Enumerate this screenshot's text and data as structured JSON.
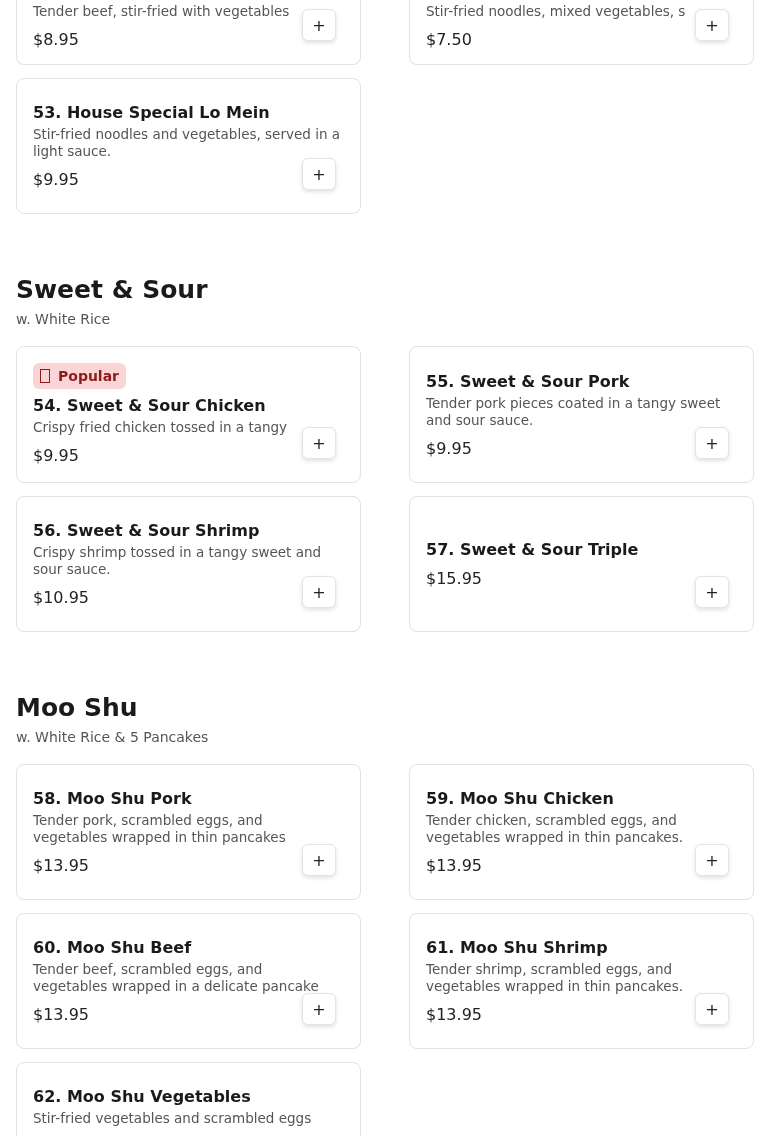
{
  "top_items": [
    {
      "description": "Tender beef, stir-fried with vegetables",
      "price": "$8.95",
      "add_label": "+"
    },
    {
      "description": "Stir-fried noodles, mixed vegetables, s",
      "price": "$7.50",
      "add_label": "+"
    }
  ],
  "top_extra": [
    {
      "title": "53. House Special Lo Mein",
      "description": "Stir-fried noodles and vegetables, served in a light sauce.",
      "price": "$9.95",
      "add_label": "+"
    }
  ],
  "sections": [
    {
      "title": "Sweet & Sour",
      "subtitle": "w. White Rice",
      "items": [
        {
          "badge": "Popular",
          "title": "54. Sweet & Sour Chicken",
          "description": "Crispy fried chicken tossed in a tangy",
          "price": "$9.95",
          "add_label": "+"
        },
        {
          "title": "55. Sweet & Sour Pork",
          "description": "Tender pork pieces coated in a tangy sweet and sour sauce.",
          "price": "$9.95",
          "add_label": "+"
        },
        {
          "title": "56. Sweet & Sour Shrimp",
          "description": "Crispy shrimp tossed in a tangy sweet and sour sauce.",
          "price": "$10.95",
          "add_label": "+"
        },
        {
          "title": "57. Sweet & Sour Triple",
          "price": "$15.95",
          "add_label": "+"
        }
      ]
    },
    {
      "title": "Moo Shu",
      "subtitle": "w. White Rice & 5 Pancakes",
      "items": [
        {
          "title": "58. Moo Shu Pork",
          "description": "Tender pork, scrambled eggs, and vegetables wrapped in thin pancakes",
          "price": "$13.95",
          "add_label": "+"
        },
        {
          "title": "59. Moo Shu Chicken",
          "description": "Tender chicken, scrambled eggs, and vegetables wrapped in thin pancakes.",
          "price": "$13.95",
          "add_label": "+"
        },
        {
          "title": "60. Moo Shu Beef",
          "description": "Tender beef, scrambled eggs, and vegetables wrapped in a delicate pancake",
          "price": "$13.95",
          "add_label": "+"
        },
        {
          "title": "61. Moo Shu Shrimp",
          "description": "Tender shrimp, scrambled eggs, and vegetables wrapped in thin pancakes.",
          "price": "$13.95",
          "add_label": "+"
        },
        {
          "title": "62. Moo Shu Vegetables",
          "description": "Stir-fried vegetables and scrambled eggs"
        }
      ]
    }
  ]
}
